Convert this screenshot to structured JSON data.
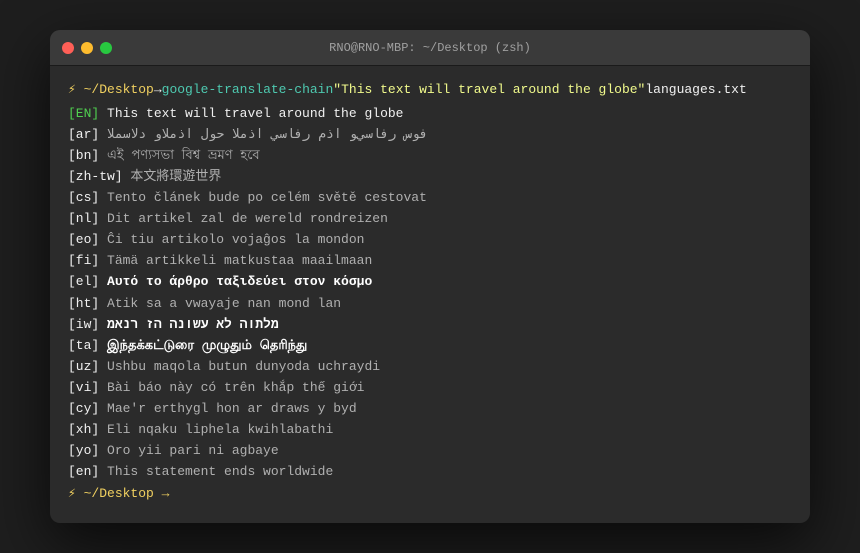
{
  "window": {
    "title": "RNO@RNO-MBP: ~/Desktop (zsh)",
    "traffic": {
      "close": "close",
      "minimize": "minimize",
      "maximize": "maximize"
    }
  },
  "terminal": {
    "prompt_prefix": "⚡ ~/Desktop",
    "prompt_arrow": " → ",
    "command": "google-translate-chain",
    "command_arg": "\"This text will travel around the globe\"",
    "command_file": " languages.txt",
    "lines": [
      {
        "tag": "[EN]",
        "content": " This text will travel around the globe"
      },
      {
        "tag": "[ar]",
        "content": " فوس رفاسي اذم رفاسي اذملا حول اذملاو دلاسملا"
      },
      {
        "tag": "[bn]",
        "content": " এই পণ্যসভা বিশ্ব ভ্রমণ হবে"
      },
      {
        "tag": "[zh-tw]",
        "content": " 本文將環遊世界"
      },
      {
        "tag": "[cs]",
        "content": " Tento článek bude po celém světě cestovat"
      },
      {
        "tag": "[nl]",
        "content": " Dit artikel zal de wereld rondreizen"
      },
      {
        "tag": "[eo]",
        "content": " Ĉi tiu artikolo vojaĝos la mondon"
      },
      {
        "tag": "[fi]",
        "content": " Tämä artikkeli matkustaa maailmaan"
      },
      {
        "tag": "[el]",
        "content": " Αυτό το άρθρο ταξιδεύει στον κόσμο"
      },
      {
        "tag": "[ht]",
        "content": " Atik sa a vwayaje nan mond lan"
      },
      {
        "tag": "[iw]",
        "content": " מלתוה לא עשונה הז רנאמ"
      },
      {
        "tag": "[ta]",
        "content": " இந்தக்கட்டுரை முழுதும் தெரிந்து"
      },
      {
        "tag": "[uz]",
        "content": " Ushbu maqola butun dunyoda uchraydi"
      },
      {
        "tag": "[vi]",
        "content": " Bài báo này có trên khắp thế giới"
      },
      {
        "tag": "[cy]",
        "content": " Mae'r erthygl hon ar draws y byd"
      },
      {
        "tag": "[xh]",
        "content": " Eli nqaku liphela kwihlabathi"
      },
      {
        "tag": "[yo]",
        "content": " Oro yii pari ni agbaye"
      },
      {
        "tag": "[en]",
        "content": " This statement ends worldwide"
      }
    ],
    "bottom_prompt": "⚡ ~/Desktop →"
  }
}
